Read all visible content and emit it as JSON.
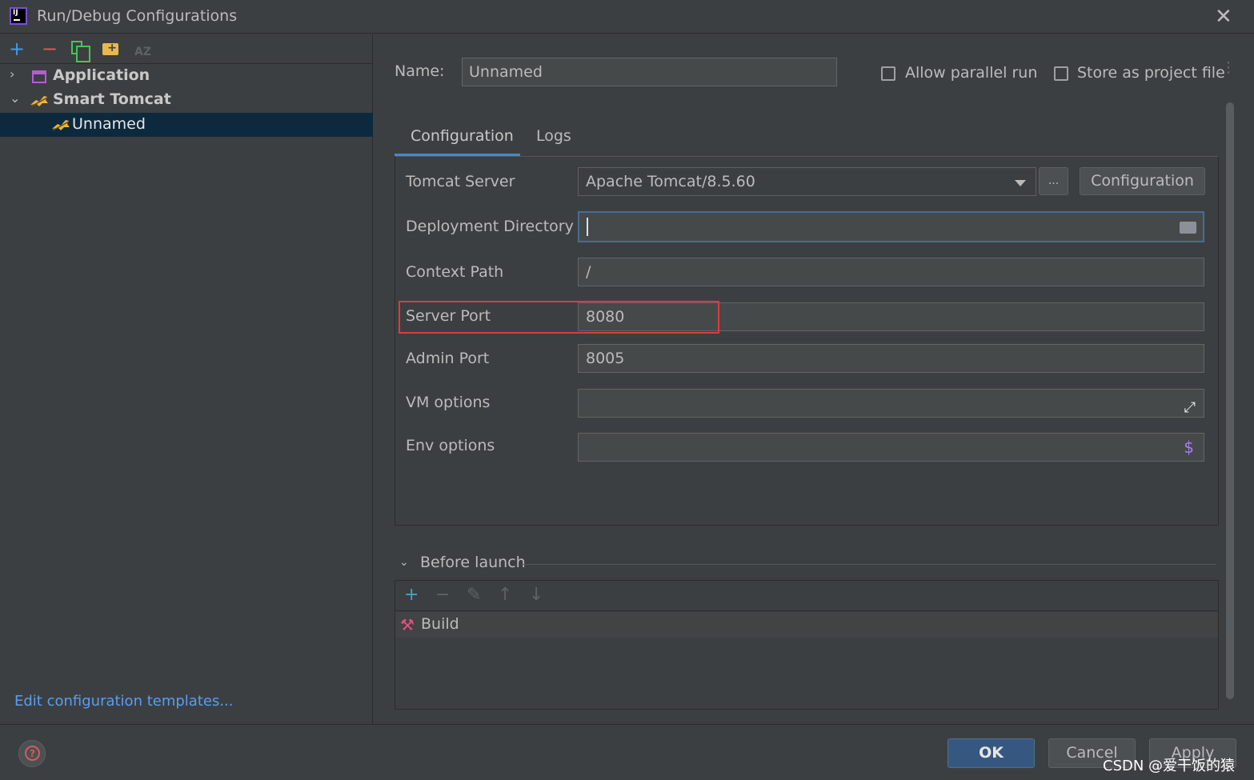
{
  "window": {
    "title": "Run/Debug Configurations",
    "app_icon_text": "IJ"
  },
  "left_toolbar": {
    "add": "+",
    "remove": "−",
    "sort": "AZ"
  },
  "tree": {
    "application": "Application",
    "smart_tomcat": "Smart Tomcat",
    "unnamed": "Unnamed"
  },
  "edit_templates_link": "Edit configuration templates...",
  "name_field": {
    "label": "Name:",
    "value": "Unnamed"
  },
  "options": {
    "allow_parallel_run": {
      "label": "Allow parallel run",
      "checked": false
    },
    "store_as_project_file": {
      "label": "Store as project file",
      "checked": false
    }
  },
  "tabs": [
    "Configuration",
    "Logs"
  ],
  "form": {
    "tomcat_server": {
      "label": "Tomcat Server",
      "value": "Apache Tomcat/8.5.60",
      "browse": "...",
      "config_button": "Configuration"
    },
    "deployment_directory": {
      "label": "Deployment Directory",
      "value": ""
    },
    "context_path": {
      "label": "Context Path",
      "value": "/"
    },
    "server_port": {
      "label": "Server Port",
      "value": "8080"
    },
    "admin_port": {
      "label": "Admin Port",
      "value": "8005"
    },
    "vm_options": {
      "label": "VM options",
      "value": ""
    },
    "env_options": {
      "label": "Env options",
      "value": "",
      "icon": "$"
    }
  },
  "before_launch": {
    "label": "Before launch",
    "toolbar": {
      "add": "+",
      "remove": "−",
      "up": "↑",
      "down": "↓"
    },
    "items": [
      "Build"
    ]
  },
  "buttons": {
    "ok": "OK",
    "cancel": "Cancel",
    "apply": "Apply"
  },
  "watermark": "CSDN @爱干饭的猿",
  "colors": {
    "accent": "#4a88c7",
    "selection": "#0d293e",
    "highlight_box": "#e03a3a",
    "link": "#589df6"
  }
}
